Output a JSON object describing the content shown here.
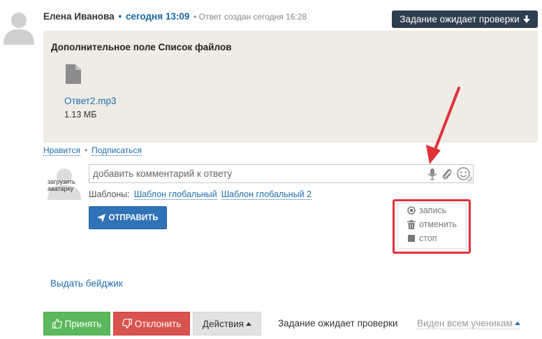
{
  "answer": {
    "author": "Елена Иванова",
    "separator": "•",
    "time": "сегодня 13:09",
    "created": "• Ответ создан сегодня 16:28",
    "status_button": "Задание ожидает проверки"
  },
  "files_panel": {
    "title": "Дополнительное поле Список файлов",
    "file": {
      "name": "Ответ2.mp3",
      "size": "1.13 МБ",
      "icon": "file-icon"
    }
  },
  "links": {
    "like": "Нравится",
    "sep": "•",
    "subscribe": "Подписаться"
  },
  "comment": {
    "avatar_label": "загрузить аватарку",
    "placeholder": "добавить комментарий к ответу",
    "icons": [
      "microphone-icon",
      "paperclip-icon",
      "smiley-icon"
    ],
    "templates_label": "Шаблоны:",
    "templates": [
      "Шаблон глобальный",
      "Шаблон глобальный 2"
    ],
    "send_label": "ОТПРАВИТЬ"
  },
  "recorder": {
    "record": "запись",
    "cancel": "отменить",
    "stop": "стоп",
    "highlight_color": "#e0313a"
  },
  "badge_link": "Выдать бейджик",
  "footer": {
    "accept": "Принять",
    "reject": "Отклонить",
    "actions": "Действия",
    "status": "Задание ожидает проверки",
    "visibility": "Виден всем ученикам"
  },
  "colors": {
    "link": "#1f6db2",
    "accept": "#5cb85c",
    "reject": "#d9534f",
    "send": "#2f72b7",
    "status_button": "#2d3e4e",
    "panel_bg": "#eeece4"
  }
}
